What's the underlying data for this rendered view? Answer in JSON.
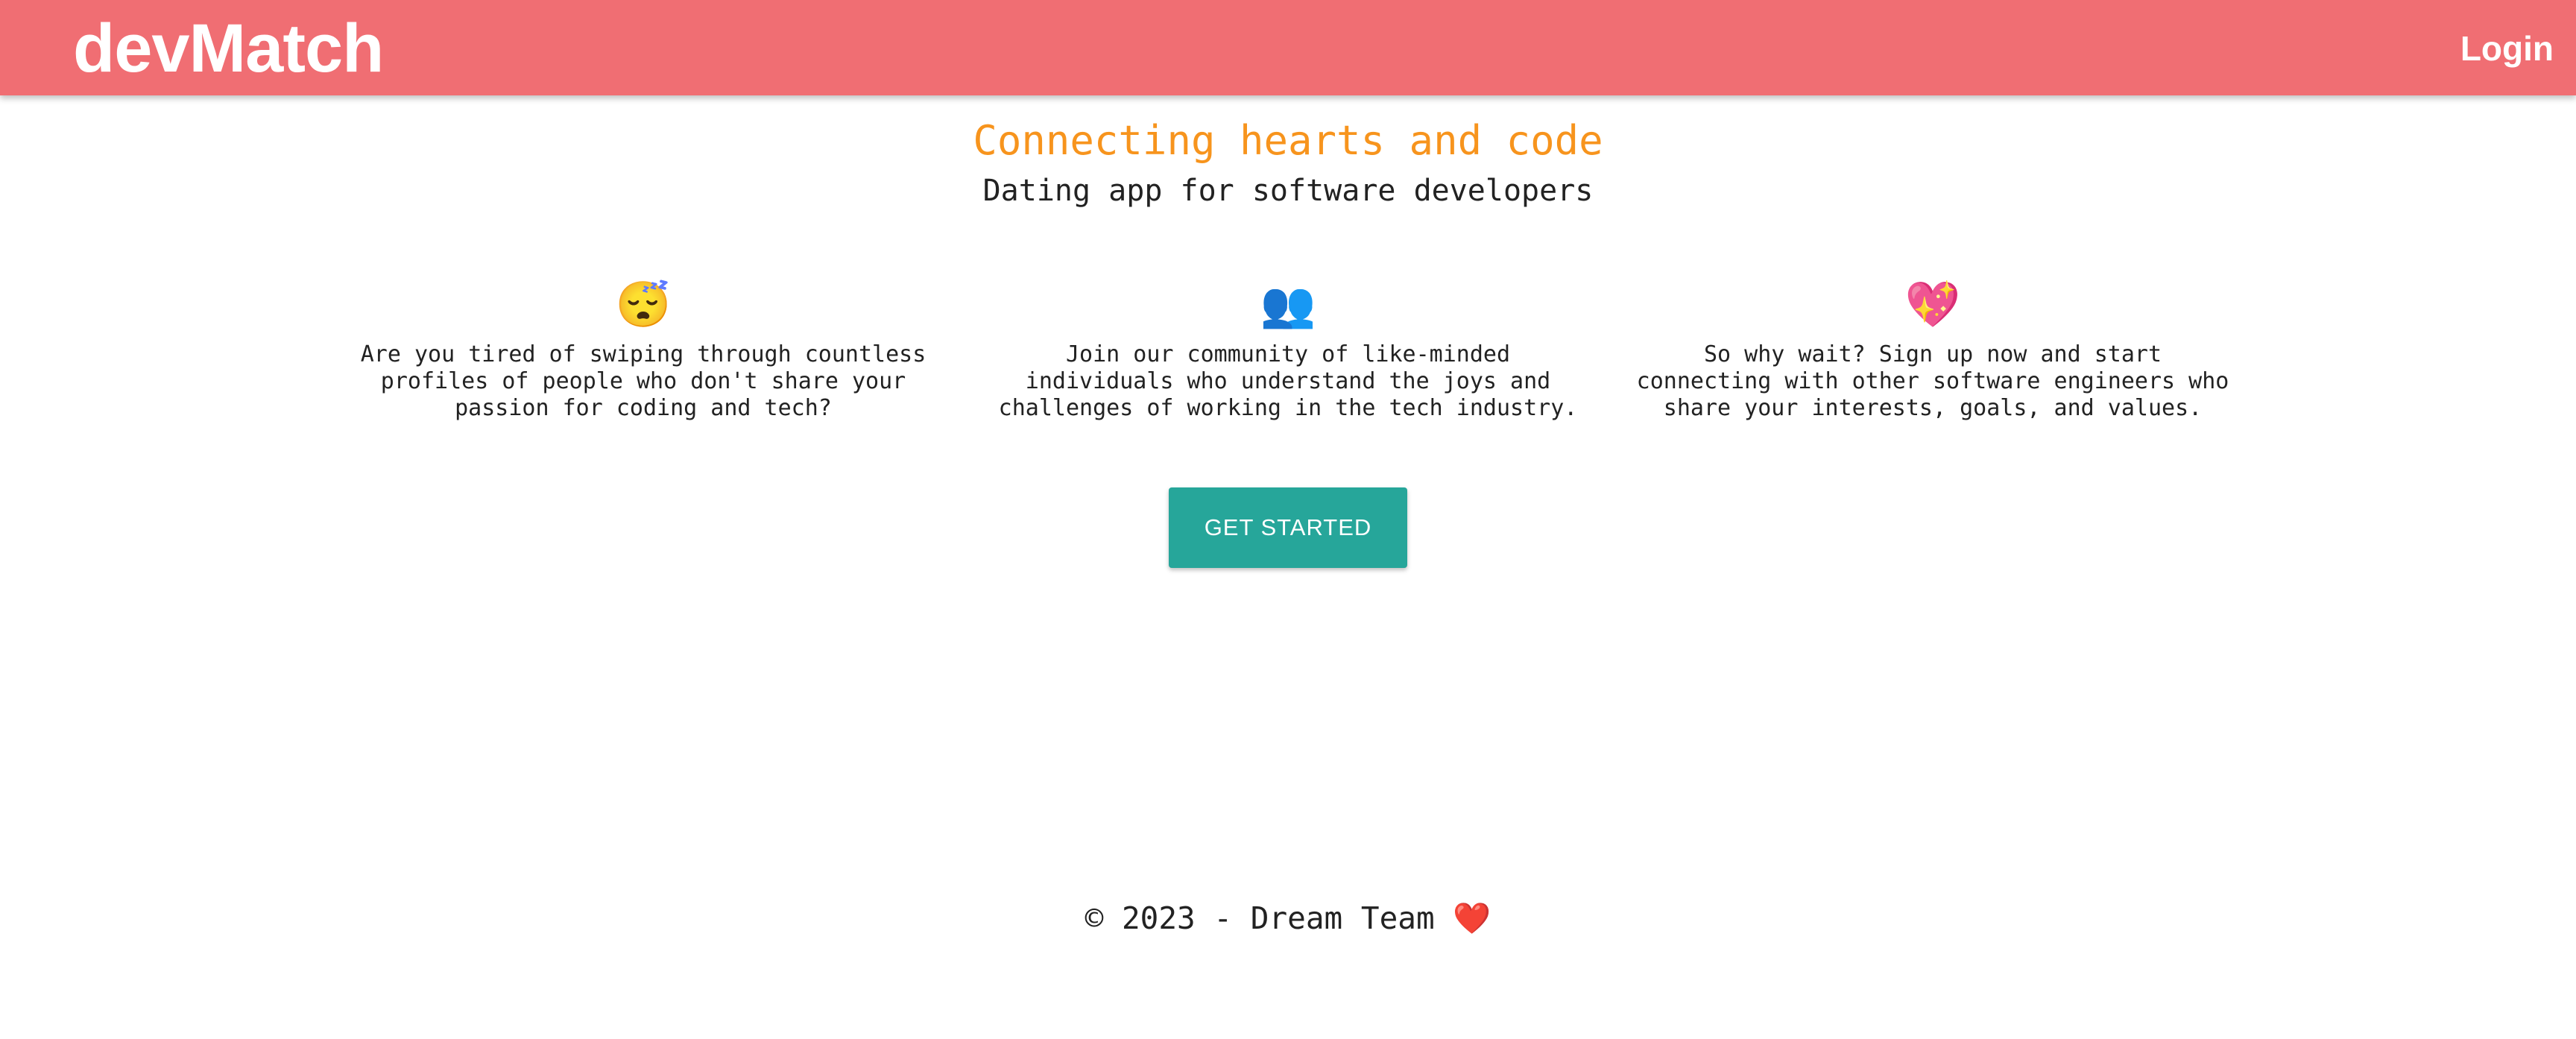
{
  "header": {
    "brand": "devMatch",
    "login_label": "Login"
  },
  "hero": {
    "title": "Connecting hearts and code",
    "subtitle": "Dating app for software developers"
  },
  "features": [
    {
      "icon": "😴",
      "icon_name": "sleepy-face-icon",
      "text": "Are you tired of swiping through countless\nprofiles of people who don't share your\npassion for coding and tech?"
    },
    {
      "icon": "👥",
      "icon_name": "people-icon",
      "text": "Join our community of like-minded\nindividuals who understand the joys and\nchallenges of working in the tech industry."
    },
    {
      "icon": "💖",
      "icon_name": "sparkling-heart-icon",
      "text": "So why wait? Sign up now and start\nconnecting with other software engineers who\nshare your interests, goals, and values."
    }
  ],
  "cta": {
    "label": "GET STARTED"
  },
  "footer": {
    "text": "© 2023 - Dream Team",
    "heart": "❤️"
  },
  "colors": {
    "header_bg": "#f06e73",
    "accent_title": "#f7941d",
    "button_bg": "#26a69a"
  }
}
